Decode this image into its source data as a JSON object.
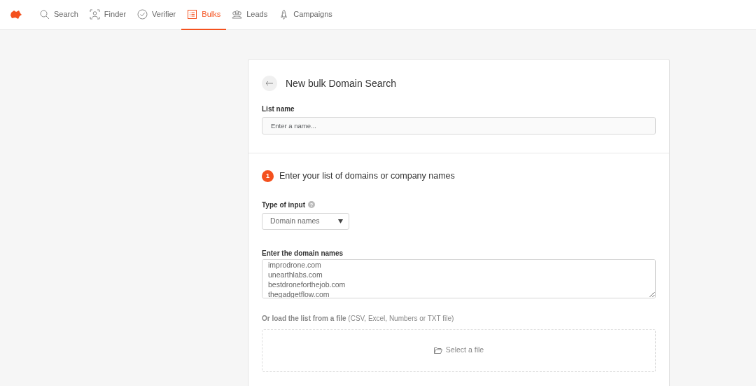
{
  "nav": {
    "items": [
      {
        "label": "Search",
        "kind": "search",
        "selected": false
      },
      {
        "label": "Finder",
        "kind": "finder",
        "selected": false
      },
      {
        "label": "Verifier",
        "kind": "verifier",
        "selected": false
      },
      {
        "label": "Bulks",
        "kind": "bulks",
        "selected": true
      },
      {
        "label": "Leads",
        "kind": "leads",
        "selected": false
      },
      {
        "label": "Campaigns",
        "kind": "campaigns",
        "selected": false
      }
    ]
  },
  "form": {
    "title": "New bulk Domain Search",
    "list_name": {
      "label": "List name",
      "placeholder": "Enter a name..."
    },
    "step": {
      "number": "1",
      "title": "Enter your list of domains or company names"
    },
    "input_type": {
      "label": "Type of input",
      "value": "Domain names",
      "help": "?"
    },
    "domains": {
      "label": "Enter the domain names",
      "lines": [
        "improdrone.com",
        "unearthlabs.com",
        "bestdroneforthejob.com",
        "thegadgetflow.com"
      ]
    },
    "file": {
      "label": "**Or load the list from a file** (CSV, Excel, Numbers or TXT file)",
      "button": "Select a file"
    }
  }
}
